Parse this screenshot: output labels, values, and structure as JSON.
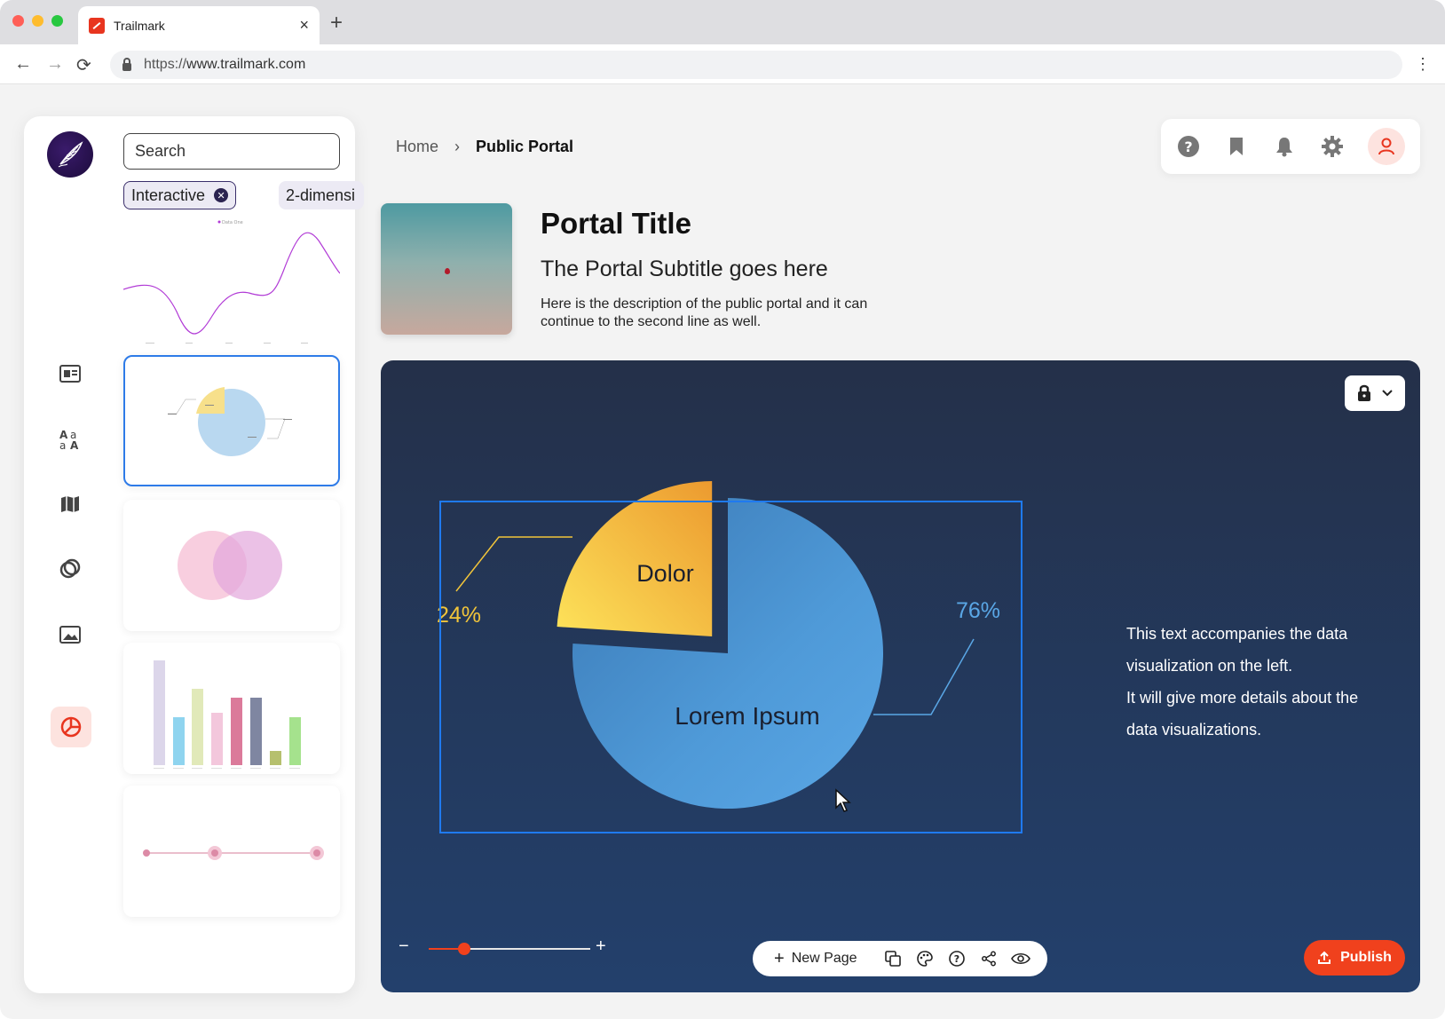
{
  "browser": {
    "tab_title": "Trailmark",
    "url_scheme": "https://",
    "url_host": "www.trailmark.com"
  },
  "sidebar": {
    "search_placeholder": "Search",
    "filters": [
      {
        "label": "Interactive",
        "active": true
      },
      {
        "label": "2-dimensi",
        "active": false
      }
    ],
    "thumb_line_legend": "Data One",
    "rail_icons": [
      "news-icon",
      "typography-icon",
      "map-icon",
      "rings-icon",
      "image-icon",
      "pie-chart-icon"
    ]
  },
  "breadcrumb": {
    "home": "Home",
    "current": "Public Portal"
  },
  "toolbar_icons": [
    "help-icon",
    "bookmark-icon",
    "bell-icon",
    "gear-icon",
    "user-icon"
  ],
  "portal": {
    "title": "Portal Title",
    "subtitle": "The Portal Subtitle goes here",
    "description": "Here is the description of the public portal and it can continue to the second line as well."
  },
  "canvas": {
    "side_text_line1": "This text accompanies the data visualization on the left.",
    "side_text_line2": "It will give more details about the data visualizations.",
    "zoom_level": 0.22,
    "new_page_label": "New Page",
    "publish_label": "Publish"
  },
  "chart_data": {
    "type": "pie",
    "labels": [
      "Dolor",
      "Lorem Ipsum"
    ],
    "values": [
      24,
      76
    ],
    "value_labels": [
      "24%",
      "76%"
    ],
    "colors": [
      "#f2b63a",
      "#4f9ad8"
    ]
  }
}
